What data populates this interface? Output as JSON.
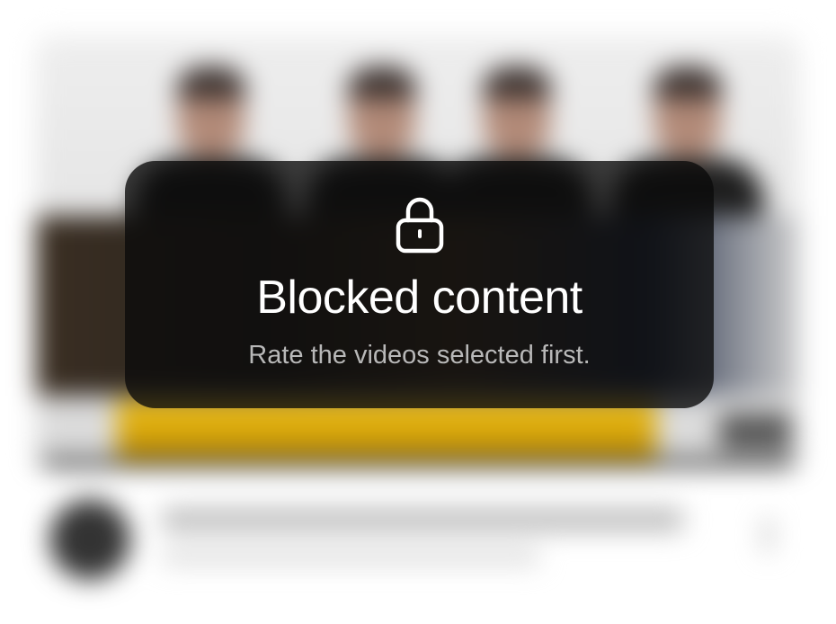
{
  "overlay": {
    "icon": "lock-icon",
    "title": "Blocked content",
    "subtitle": "Rate the videos selected first."
  },
  "colors": {
    "overlay_background": "#0a0a0a",
    "title_text": "#ffffff",
    "subtitle_text": "#b8b8b8",
    "thumbnail_banner": "#f3c10f"
  }
}
